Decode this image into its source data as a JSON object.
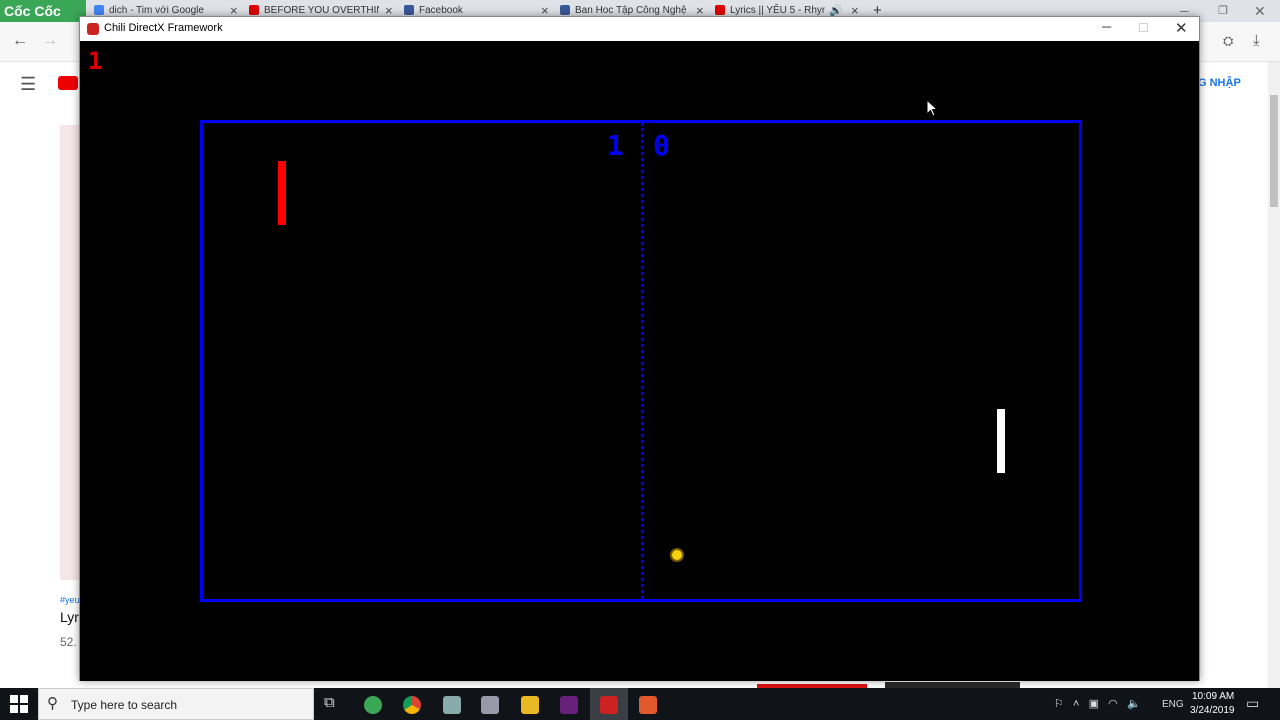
{
  "browser": {
    "brand": "Cốc Cốc",
    "tabs": [
      {
        "title": "dich - Tim với Google",
        "color": "#4285f4"
      },
      {
        "title": "BEFORE YOU OVERTHINK",
        "color": "#e00000"
      },
      {
        "title": "Facebook",
        "color": "#3b5998"
      },
      {
        "title": "Ban Hoc Tập Công Nghệ",
        "color": "#3b5998"
      },
      {
        "title": "Lyrics || YÊU 5 - Rhym",
        "color": "#e00000"
      }
    ],
    "login_label": "G NHẬP"
  },
  "background_page": {
    "tag": "#yeu",
    "title": "Lyr",
    "views": "52."
  },
  "game_window": {
    "title": "Chili DirectX Framework",
    "debug_counter": "1",
    "score_left": "1",
    "score_right": "0",
    "colors": {
      "court": "#0000f0",
      "paddle_left": "#ff0000",
      "paddle_right": "#ffffff",
      "ball": "#f5d20a",
      "background": "#000000"
    }
  },
  "taskbar": {
    "search_placeholder": "Type here to search",
    "language": "ENG",
    "time": "10:09 AM",
    "date": "3/24/2019",
    "apps": [
      "file-explorer-icon",
      "chrome-icon",
      "coccoc-icon",
      "paint-icon",
      "folder-icon",
      "visual-studio-icon",
      "chili-app-icon",
      "snip-icon"
    ]
  }
}
